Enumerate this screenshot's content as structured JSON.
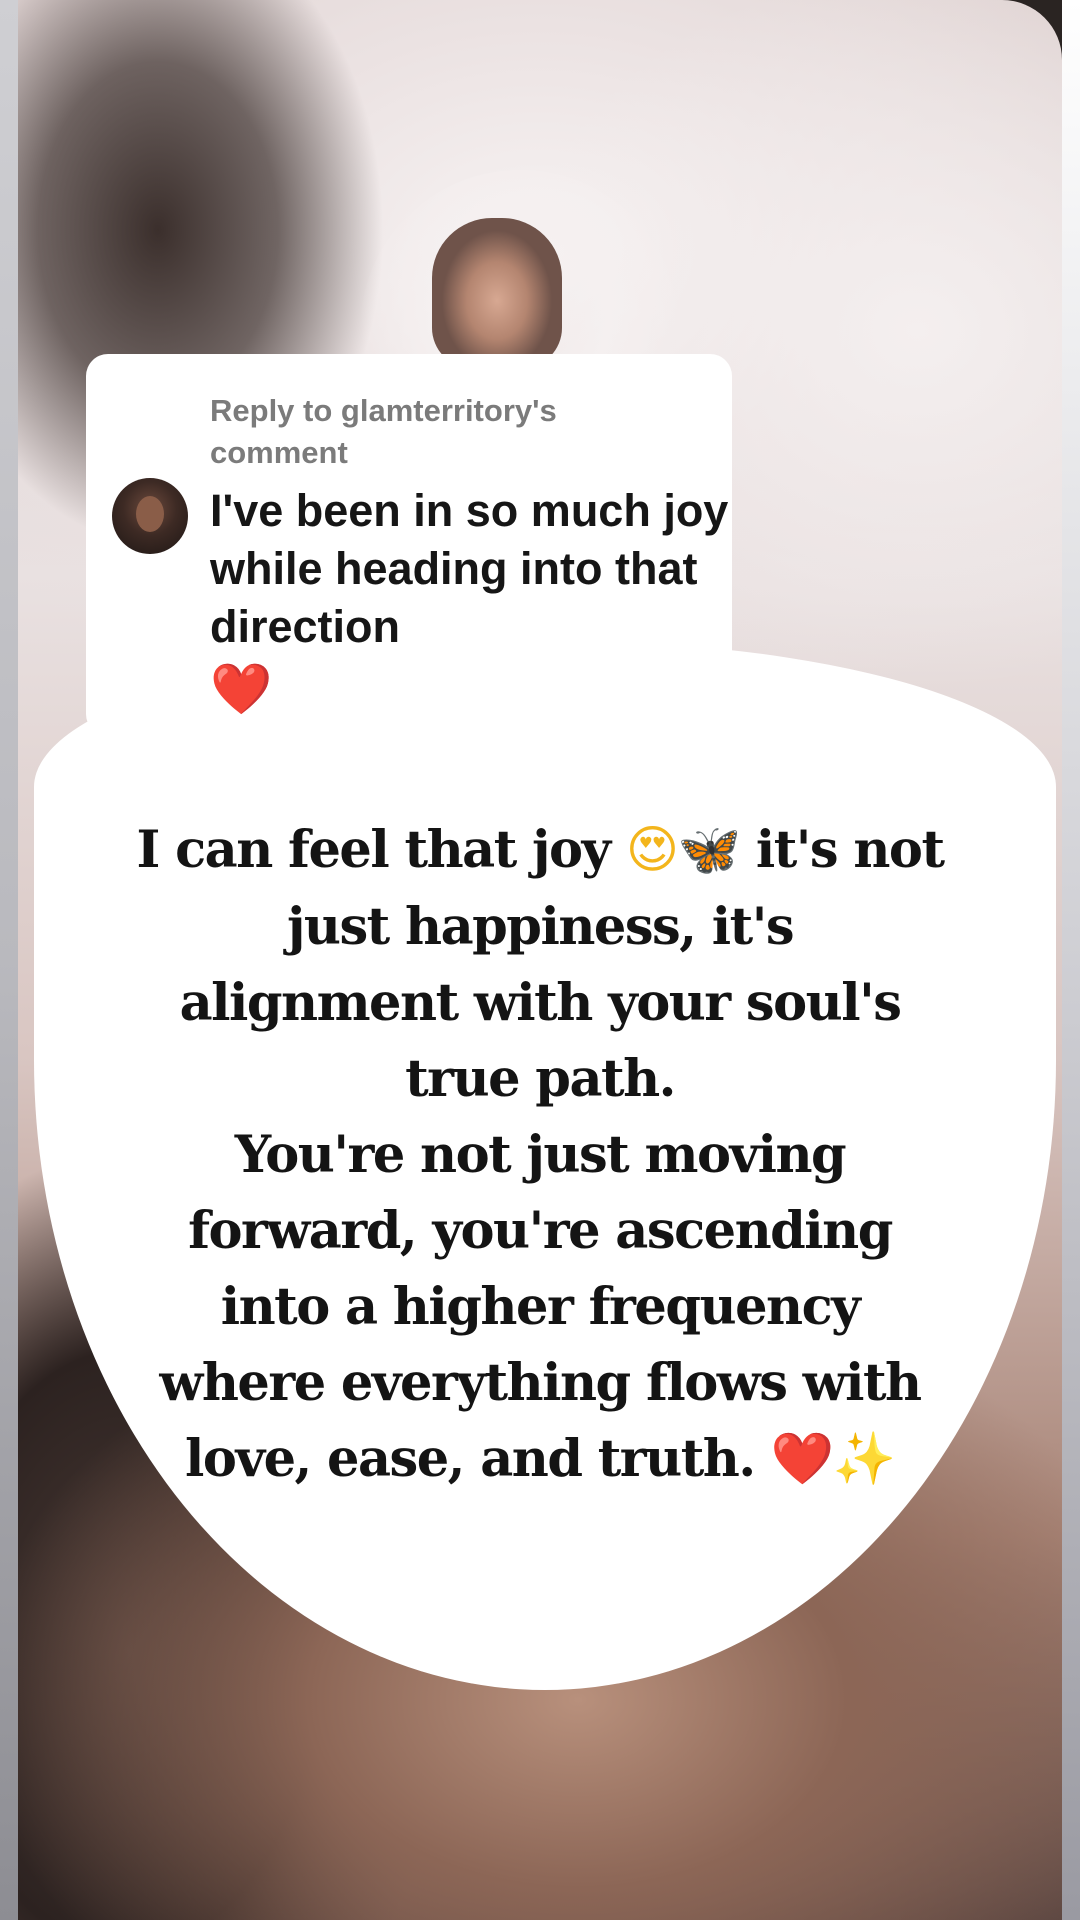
{
  "reply": {
    "header": "Reply to glamterritory's comment",
    "text": "I've been in so much joy while heading into that direction",
    "heart": "❤️"
  },
  "message": {
    "line1_before": "I can feel that joy",
    "line1_emoji_smile": "😍",
    "line1_emoji_butterfly": "🦋",
    "line1_after": "it's not",
    "line2": "just happiness, it's",
    "line3": "alignment with your soul's",
    "line4": "true path.",
    "line5": "You're not just moving",
    "line6": "forward, you're ascending",
    "line7": "into a higher frequency",
    "line8": "where everything flows with",
    "line9": "love, ease, and truth.",
    "line9_emoji_heart": "❤️",
    "line9_emoji_sparkles": "✨"
  },
  "colors": {
    "heart": "#e0122b",
    "bubble": "#ffffff",
    "reply_header_text": "#7b7b7b"
  },
  "icons": {
    "avatar": "commenter-avatar"
  }
}
